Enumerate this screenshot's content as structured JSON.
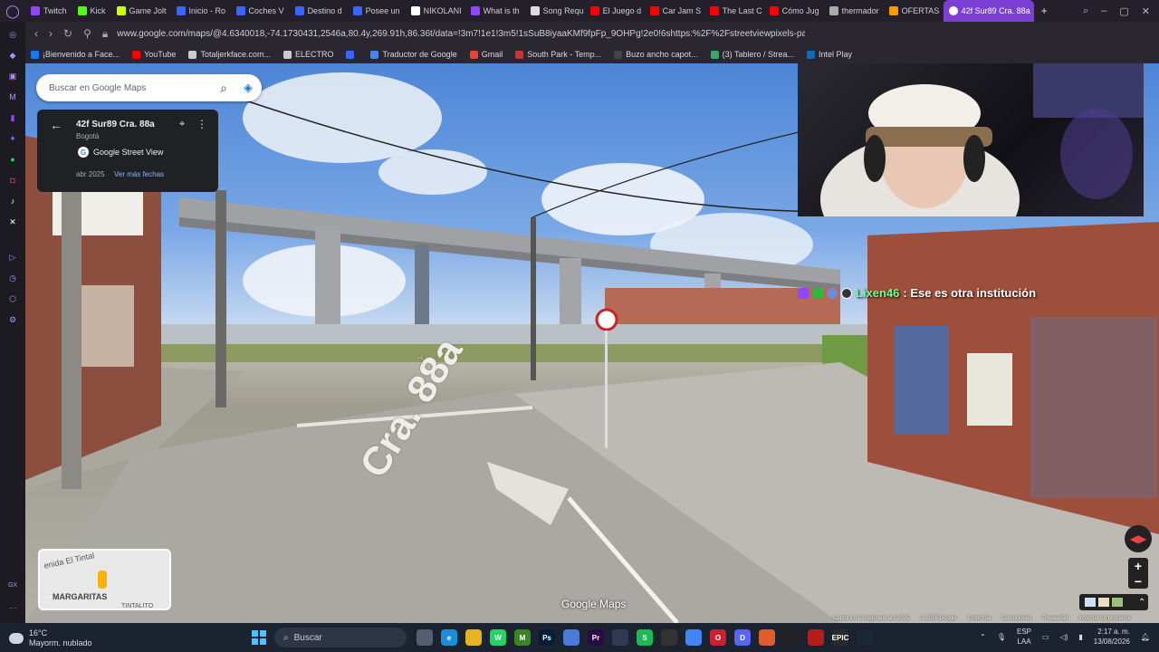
{
  "browser": {
    "tabs": [
      {
        "label": "Twitch",
        "color": "#9146ff"
      },
      {
        "label": "Kick",
        "color": "#53fc18"
      },
      {
        "label": "Game Jolt",
        "color": "#ccff00"
      },
      {
        "label": "Inicio - Ro",
        "color": "#3a66ff"
      },
      {
        "label": "Coches V",
        "color": "#3a66ff"
      },
      {
        "label": "Destino d",
        "color": "#3a66ff"
      },
      {
        "label": "Posee un",
        "color": "#3a66ff"
      },
      {
        "label": "NIKOLANI",
        "color": "#ffffff"
      },
      {
        "label": "What is th",
        "color": "#9146ff"
      },
      {
        "label": "Song Requ",
        "color": "#dddddd"
      },
      {
        "label": "El Juego d",
        "color": "#ff0000"
      },
      {
        "label": "Car Jam S",
        "color": "#ff0000"
      },
      {
        "label": "The Last C",
        "color": "#ff0000"
      },
      {
        "label": "Cómo Jug",
        "color": "#ff0000"
      },
      {
        "label": "thermador",
        "color": "#aaaaaa"
      },
      {
        "label": "OFERTAS",
        "color": "#ff9900"
      }
    ],
    "active_tab": "42f Sur89 Cra. 88a",
    "url": "www.google.com/maps/@4.6340018,-74.1730431,2546a,80.4y,269.91h,86.36t/data=!3m7!1e1!3m5!1sSuB8iyaaKMf9fpFp_9OHPg!2e0!6shttps:%2F%2Fstreetviewpixels-pa.googleapis",
    "bookmarks": [
      {
        "label": "¡Bienvenido a Face...",
        "color": "#1877f2"
      },
      {
        "label": "YouTube",
        "color": "#ff0000"
      },
      {
        "label": "Totaljerkface.com...",
        "color": "#cccccc"
      },
      {
        "label": "ELECTRO",
        "color": "#cccccc"
      },
      {
        "label": "",
        "color": "#3a66ff"
      },
      {
        "label": "Traductor de Google",
        "color": "#4285f4"
      },
      {
        "label": "Gmail",
        "color": "#ea4335"
      },
      {
        "label": "South Park - Temp...",
        "color": "#cc3333"
      },
      {
        "label": "Buzo ancho capot...",
        "color": "#444444"
      },
      {
        "label": "(3) Tablero / Strea...",
        "color": "#33aa66"
      },
      {
        "label": "Intel Play",
        "color": "#0071c5"
      }
    ]
  },
  "maps": {
    "search_placeholder": "Buscar en Google Maps",
    "place_title": "42f Sur89 Cra. 88a",
    "place_city": "Bogotá",
    "source": "Google Street View",
    "date": "abr 2025",
    "more_dates": "Ver más fechas",
    "minimap_labels": [
      "enida El Tintal",
      "MARGARITAS",
      "TINTALITO"
    ],
    "logo": "Google Maps",
    "footer": [
      "Captura de imágenes: abr 2025",
      "© 2026 Google",
      "Colombia",
      "Condiciones",
      "Privacidad",
      "Informar un problema"
    ],
    "street_marking": "Cra. 88a"
  },
  "chat": {
    "user": "Lixen46",
    "message": ": Ese es otra institución"
  },
  "taskbar": {
    "weather_temp": "16°C",
    "weather_desc": "Mayorm. nublado",
    "search_label": "Buscar",
    "lang_top": "ESP",
    "lang_bottom": "LAA",
    "time": "2:17 a. m.",
    "date": "13/08/2026",
    "apps": [
      {
        "label": "",
        "color": "#555e70"
      },
      {
        "label": "e",
        "color": "#1a8fd8"
      },
      {
        "label": "",
        "color": "#e6b422"
      },
      {
        "label": "W",
        "color": "#25d366"
      },
      {
        "label": "M",
        "color": "#3c8527"
      },
      {
        "label": "Ps",
        "color": "#001e36"
      },
      {
        "label": "",
        "color": "#4a7bd9"
      },
      {
        "label": "Pr",
        "color": "#2a0a45"
      },
      {
        "label": "",
        "color": "#2f3b52"
      },
      {
        "label": "S",
        "color": "#1db954"
      },
      {
        "label": "",
        "color": "#333333"
      },
      {
        "label": "",
        "color": "#4285f4"
      },
      {
        "label": "O",
        "color": "#cc1f2f"
      },
      {
        "label": "D",
        "color": "#5865f2"
      },
      {
        "label": "",
        "color": "#e05d2f"
      },
      {
        "label": "",
        "color": "#222222"
      },
      {
        "label": "",
        "color": "#b71c1c"
      },
      {
        "label": "EPIC",
        "color": "#2a2a2a"
      },
      {
        "label": "",
        "color": "#1b2838"
      }
    ]
  }
}
